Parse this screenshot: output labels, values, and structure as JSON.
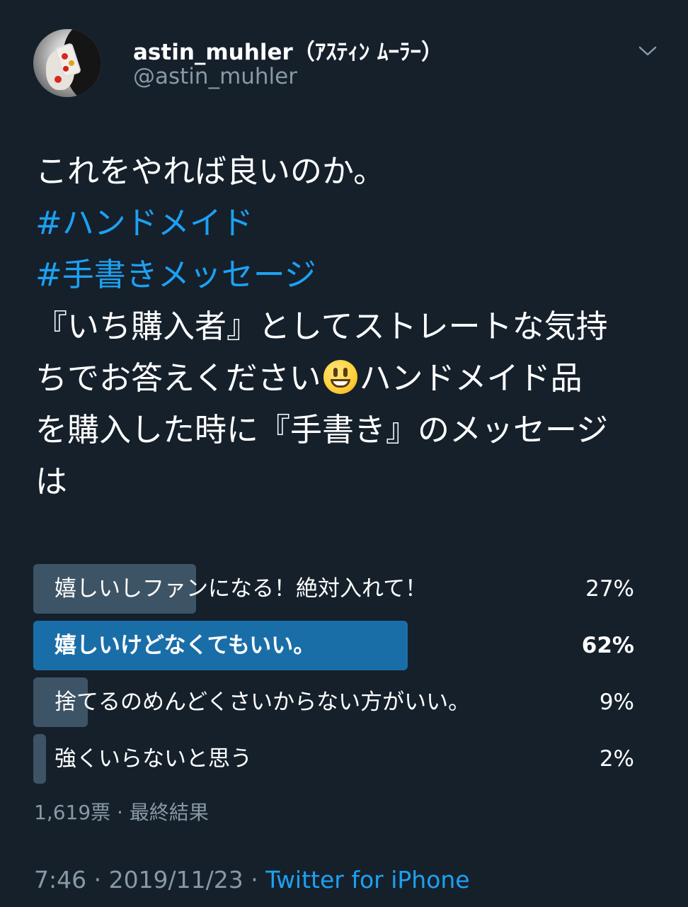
{
  "header": {
    "display_name": "astin_muhler（ｱｽﾃｨﾝ ﾑｰﾗｰ）",
    "handle": "@astin_muhler",
    "menu_icon": "chevron-down-icon"
  },
  "tweet": {
    "line1": "これをやれば良いのか。",
    "hashtag1": "#ハンドメイド",
    "hashtag2": "#手書きメッセージ",
    "line4": "『いち購入者』としてストレートな気持",
    "line5a": "ちでお答えください",
    "emoji": "grinning-face-emoji",
    "line5b": "ハンドメイド品",
    "line6": "を購入した時に『手書き』のメッセージ",
    "line7": "は"
  },
  "poll": {
    "options": [
      {
        "label": "嬉しいしファンになる！絶対入れて！",
        "percent_text": "27%",
        "percent": 27,
        "winner": false
      },
      {
        "label": "嬉しいけどなくてもいい。",
        "percent_text": "62%",
        "percent": 62,
        "winner": true
      },
      {
        "label": "捨てるのめんどくさいからない方がいい。",
        "percent_text": "9%",
        "percent": 9,
        "winner": false
      },
      {
        "label": "強くいらないと思う",
        "percent_text": "2%",
        "percent": 2,
        "winner": false
      }
    ],
    "meta": "1,619票 · 最終結果",
    "bar_color": "#3d5466",
    "winner_color": "#1a6ea8"
  },
  "footer": {
    "time": "7:46 · 2019/11/23 · ",
    "source": "Twitter for iPhone"
  },
  "colors": {
    "background": "#15202b",
    "link": "#1da1f2",
    "secondary_text": "#8899a6"
  }
}
